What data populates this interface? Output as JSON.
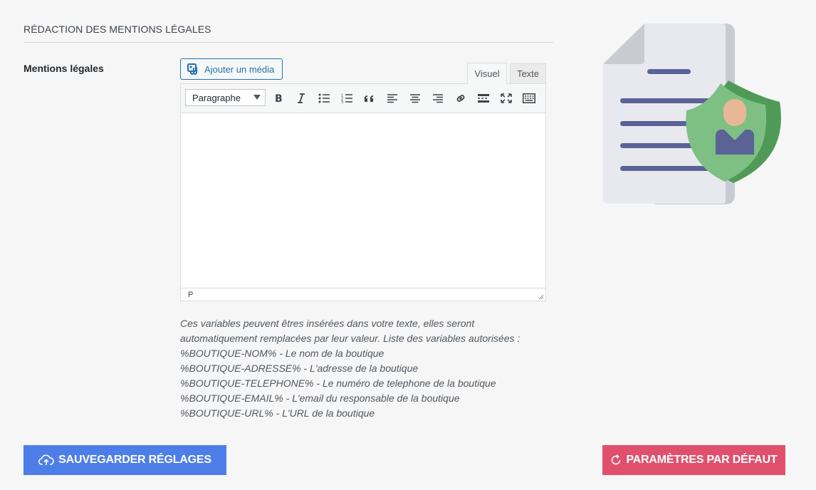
{
  "section": {
    "title": "RÉDACTION DES MENTIONS LÉGALES"
  },
  "field": {
    "label": "Mentions légales"
  },
  "editor": {
    "add_media_label": "Ajouter un média",
    "tabs": [
      {
        "label": "Visuel",
        "active": true
      },
      {
        "label": "Texte",
        "active": false
      }
    ],
    "format_select": "Paragraphe",
    "toolbar_icons": [
      "bold-icon",
      "italic-icon",
      "bullet-list-icon",
      "numbered-list-icon",
      "blockquote-icon",
      "align-left-icon",
      "align-center-icon",
      "align-right-icon",
      "link-icon",
      "read-more-icon",
      "fullscreen-icon",
      "toolbar-toggle-icon"
    ],
    "content": "",
    "status_path": "P"
  },
  "help": {
    "lines": [
      "Ces variables peuvent êtres insérées dans votre texte, elles seront",
      "automatiquement remplacées par leur valeur. Liste des variables autorisées :",
      "%BOUTIQUE-NOM% - Le nom de la boutique",
      "%BOUTIQUE-ADRESSE% - L'adresse de la boutique",
      "%BOUTIQUE-TELEPHONE% - Le numéro de telephone de la boutique",
      "%BOUTIQUE-EMAIL% - L'email du responsable de la boutique",
      "%BOUTIQUE-URL% - L'URL de la boutique"
    ]
  },
  "actions": {
    "save_label": "SAUVEGARDER RÉGLAGES",
    "reset_label": "PARAMÈTRES PAR DÉFAUT"
  },
  "colors": {
    "save_button": "#4d7ee8",
    "reset_button": "#e0506d",
    "link_blue": "#2271b1",
    "document": "#e8e9ee",
    "document_lines": "#5a6296",
    "shield": "#7ebf84",
    "shield_dark": "#4f9a57"
  }
}
